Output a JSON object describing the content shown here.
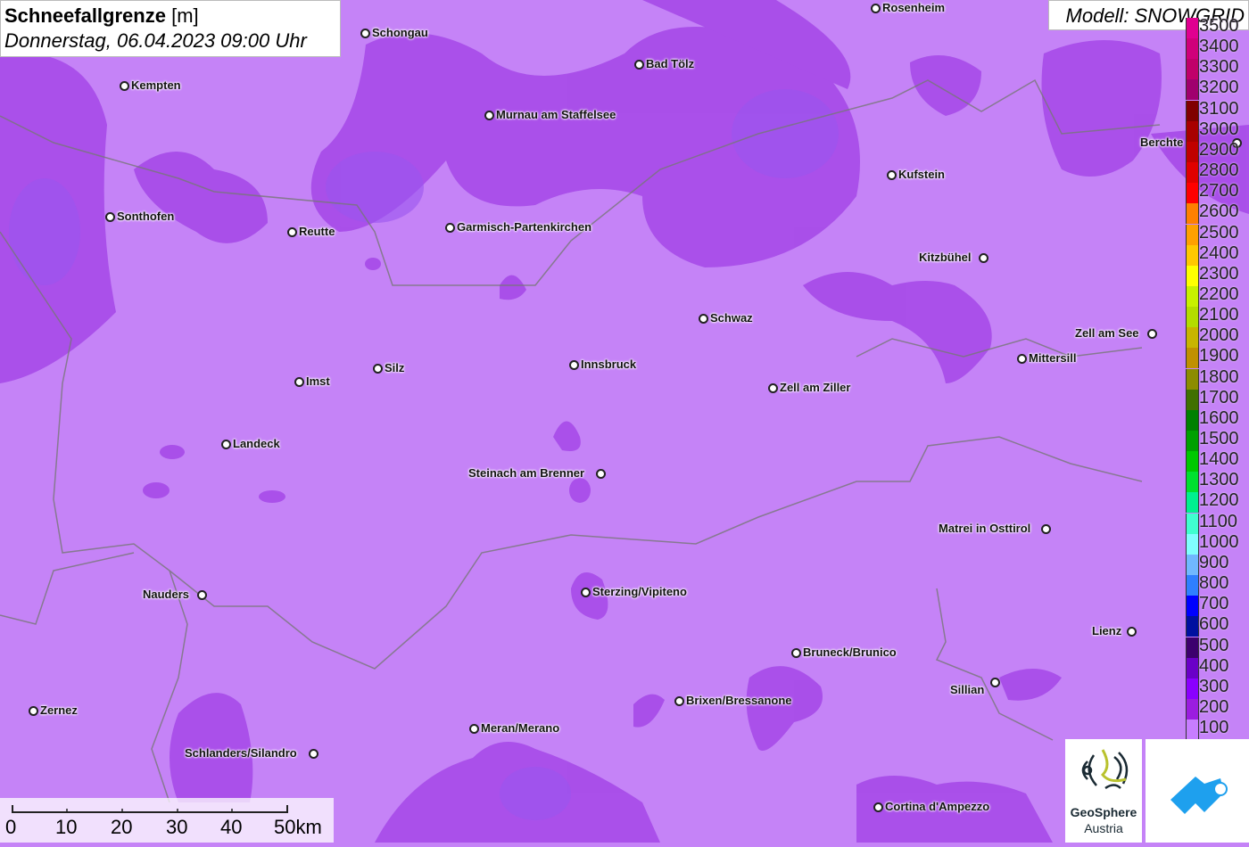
{
  "title": {
    "param": "Schneefallgrenze",
    "unit": "[m]",
    "datetime": "Donnerstag, 06.04.2023 09:00 Uhr"
  },
  "model_label": "Modell: SNOWGRID",
  "cities": [
    "Rosenheim",
    "Schongau",
    "Kempten",
    "Bad Tölz",
    "Murnau am Staffelsee",
    "Berchte",
    "Kufstein",
    "Sonthofen",
    "Reutte",
    "Garmisch-Partenkirchen",
    "Kitzbühel",
    "Schwaz",
    "Zell am See",
    "Mittersill",
    "Imst",
    "Silz",
    "Innsbruck",
    "Zell am Ziller",
    "Landeck",
    "Steinach am Brenner",
    "Matrei in Osttirol",
    "Nauders",
    "Sterzing/Vipiteno",
    "Lienz",
    "Bruneck/Brunico",
    "Sillian",
    "Brixen/Bressanone",
    "Zernez",
    "Meran/Merano",
    "Schlanders/Silandro",
    "Cortina d'Ampezzo"
  ],
  "legend": {
    "labels": [
      "3500",
      "3400",
      "3300",
      "3200",
      "3100",
      "3000",
      "2900",
      "2800",
      "2700",
      "2600",
      "2500",
      "2400",
      "2300",
      "2200",
      "2100",
      "2000",
      "1900",
      "1800",
      "1700",
      "1600",
      "1500",
      "1400",
      "1300",
      "1200",
      "1100",
      "1000",
      "900",
      "800",
      "700",
      "600",
      "500",
      "400",
      "300",
      "200",
      "100"
    ],
    "colors": [
      "#e00090",
      "#d0007a",
      "#c0006a",
      "#a0006e",
      "#800000",
      "#a80000",
      "#c00000",
      "#e00000",
      "#ff0000",
      "#ff8000",
      "#ffa000",
      "#ffc800",
      "#ffff00",
      "#c8f000",
      "#b4dc00",
      "#c8b400",
      "#c09000",
      "#8c8c00",
      "#407000",
      "#008000",
      "#00a000",
      "#00c800",
      "#00e030",
      "#00f090",
      "#40ffd0",
      "#80ffff",
      "#70b8ff",
      "#2f7fff",
      "#0000ff",
      "#0010a0",
      "#3c006e",
      "#6a00c8",
      "#8a00ff",
      "#9b1de0",
      "#c77dff"
    ]
  },
  "scale": {
    "labels": [
      "0",
      "10",
      "20",
      "30",
      "40",
      "50km"
    ]
  },
  "logos": {
    "geosphere_line1": "GeoSphere",
    "geosphere_line2": "Austria"
  }
}
